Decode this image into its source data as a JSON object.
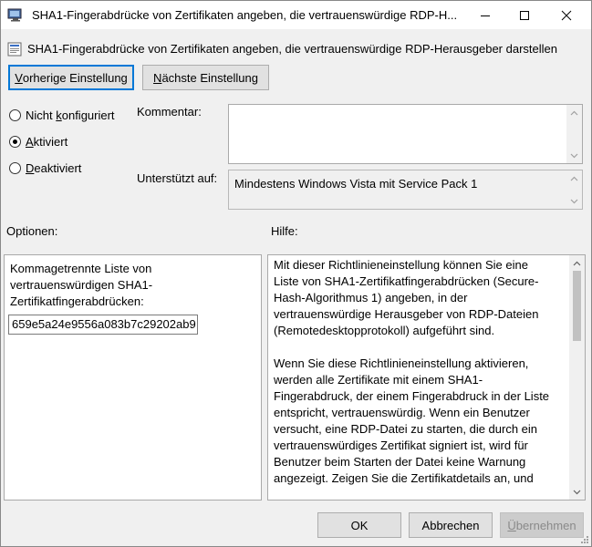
{
  "window": {
    "title": "SHA1-Fingerabdrücke von Zertifikaten angeben, die vertrauenswürdige RDP-H..."
  },
  "header": {
    "title": "SHA1-Fingerabdrücke von Zertifikaten angeben, die vertrauenswürdige RDP-Herausgeber darstellen"
  },
  "nav": {
    "prev_mnemonic": "V",
    "prev_rest": "orherige Einstellung",
    "next_mnemonic": "N",
    "next_rest": "ächste Einstellung"
  },
  "state": {
    "not_configured_pre": "Nicht ",
    "not_configured_mnemonic": "k",
    "not_configured_post": "onfiguriert",
    "enabled_mnemonic": "A",
    "enabled_rest": "ktiviert",
    "disabled_mnemonic": "D",
    "disabled_rest": "eaktiviert",
    "selected": "enabled"
  },
  "comment": {
    "label": "Kommentar:",
    "value": ""
  },
  "supported": {
    "label": "Unterstützt auf:",
    "value": "Mindestens Windows Vista mit Service Pack 1"
  },
  "options": {
    "label": "Optionen:",
    "description": "Kommagetrennte Liste von vertrauenswürdigen SHA1-Zertifikatfingerabdrücken:",
    "thumbprints_value": "659e5a24e9556a083b7c29202ab9"
  },
  "help": {
    "label": "Hilfe:",
    "paragraphs": [
      "Mit dieser Richtlinieneinstellung können Sie eine Liste von SHA1-Zertifikatfingerabdrücken (Secure-Hash-Algorithmus 1) angeben, in der vertrauenswürdige Herausgeber von RDP-Dateien (Remotedesktopprotokoll) aufgeführt sind.",
      "Wenn Sie diese Richtlinieneinstellung aktivieren, werden alle Zertifikate mit einem SHA1-Fingerabdruck, der einem Fingerabdruck in der Liste entspricht, vertrauenswürdig. Wenn ein Benutzer versucht, eine RDP-Datei zu starten, die durch ein vertrauenswürdiges Zertifikat signiert ist, wird für Benutzer beim Starten der Datei keine Warnung angezeigt. Zeigen Sie die Zertifikatdetails an, und"
    ]
  },
  "footer": {
    "ok_label": "OK",
    "cancel_label": "Abbrechen",
    "apply_mnemonic": "Ü",
    "apply_rest": "bernehmen"
  },
  "colors": {
    "accent": "#0078d7",
    "dialog_bg": "#f0f0f0"
  }
}
